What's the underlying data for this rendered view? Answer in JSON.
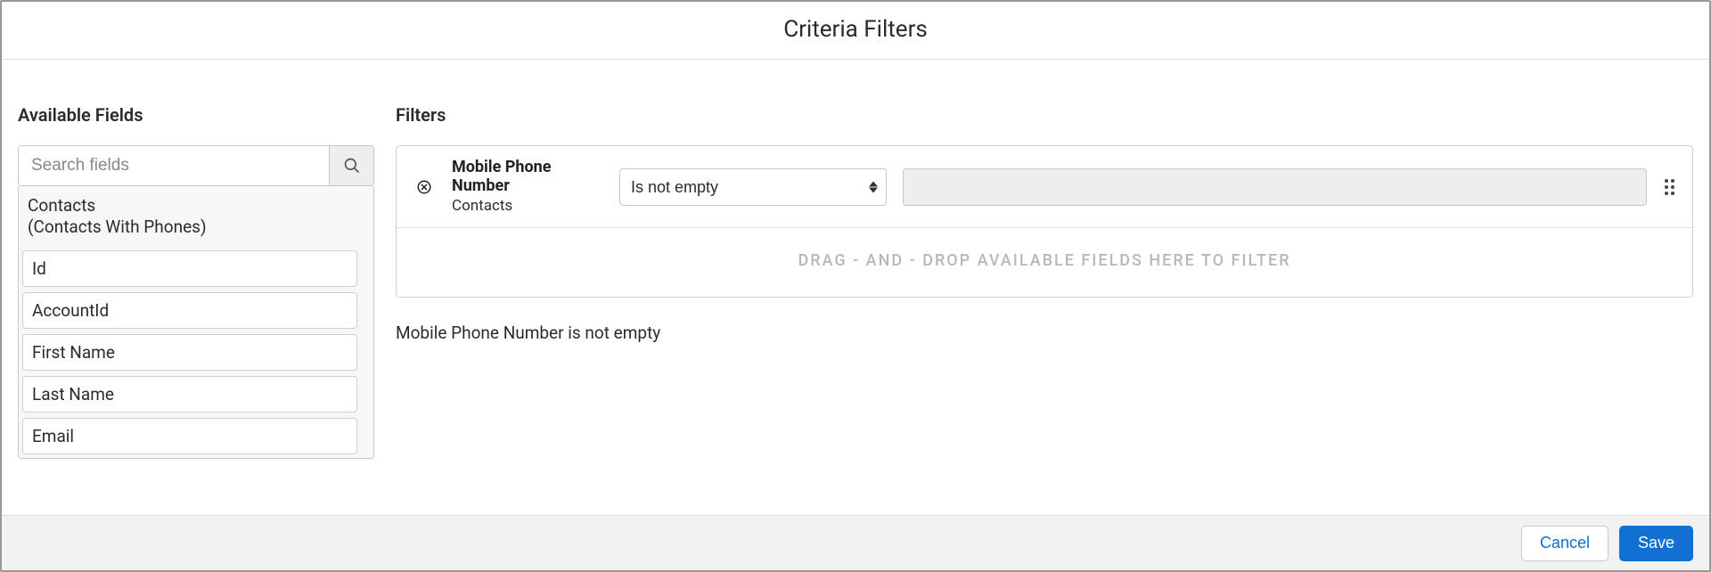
{
  "header": {
    "title": "Criteria Filters"
  },
  "sidebar": {
    "title": "Available Fields",
    "search_placeholder": "Search fields",
    "group_name": "Contacts",
    "group_sub": "(Contacts With Phones)",
    "items": [
      {
        "label": "Id"
      },
      {
        "label": "AccountId"
      },
      {
        "label": "First Name"
      },
      {
        "label": "Last Name"
      },
      {
        "label": "Email"
      }
    ]
  },
  "filters": {
    "title": "Filters",
    "rows": [
      {
        "field_name": "Mobile Phone Number",
        "field_source": "Contacts",
        "operator": "Is not empty",
        "value": ""
      }
    ],
    "drop_hint": "DRAG - AND - DROP AVAILABLE FIELDS HERE TO FILTER",
    "summary": "Mobile Phone Number is not empty"
  },
  "footer": {
    "cancel": "Cancel",
    "save": "Save"
  }
}
